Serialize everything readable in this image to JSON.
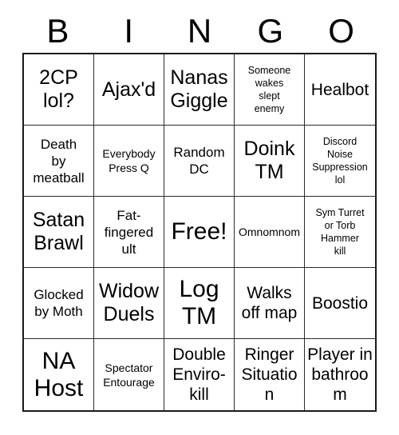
{
  "card": {
    "title": "BINGO",
    "header": {
      "letters": [
        "B",
        "I",
        "N",
        "G",
        "O"
      ]
    },
    "grid": {
      "rows": 5,
      "columns": 5,
      "free_space_index": 12,
      "border_color": "#1a1a1a",
      "line_color": "#2b2b2b",
      "background_color": "#ffffff",
      "text_color": "#000000"
    },
    "cells": [
      {
        "text": "2CP\nlol?",
        "size": "lg"
      },
      {
        "text": "Ajax'd",
        "size": "lg"
      },
      {
        "text": "Nanas\nGiggle",
        "size": "lg"
      },
      {
        "text": "Someone\nwakes\nslept\nenemy",
        "size": "xxs"
      },
      {
        "text": "Healbot",
        "size": "md"
      },
      {
        "text": "Death\nby\nmeatball",
        "size": "sm"
      },
      {
        "text": "Everybody\nPress Q",
        "size": "xs"
      },
      {
        "text": "Random\nDC",
        "size": "sm"
      },
      {
        "text": "Doink\nTM",
        "size": "lg"
      },
      {
        "text": "Discord\nNoise\nSuppression\nlol",
        "size": "xxs"
      },
      {
        "text": "Satan\nBrawl",
        "size": "lg"
      },
      {
        "text": "Fat-\nfingered\nult",
        "size": "sm"
      },
      {
        "text": "Free!",
        "size": "xl"
      },
      {
        "text": "Omnomnom",
        "size": "xs"
      },
      {
        "text": "Sym Turret\nor Torb\nHammer\nkill",
        "size": "xxs"
      },
      {
        "text": "Glocked\nby Moth",
        "size": "sm"
      },
      {
        "text": "Widow\nDuels",
        "size": "lg"
      },
      {
        "text": "Log\nTM",
        "size": "xl"
      },
      {
        "text": "Walks\noff map",
        "size": "md"
      },
      {
        "text": "Boostio",
        "size": "md"
      },
      {
        "text": "NA\nHost",
        "size": "xl"
      },
      {
        "text": "Spectator\nEntourage",
        "size": "xs"
      },
      {
        "text": "Double\nEnviro-\nkill",
        "size": "md"
      },
      {
        "text": "Ringer\nSituation",
        "size": "md"
      },
      {
        "text": "Player in\nbathroom",
        "size": "md"
      }
    ]
  }
}
